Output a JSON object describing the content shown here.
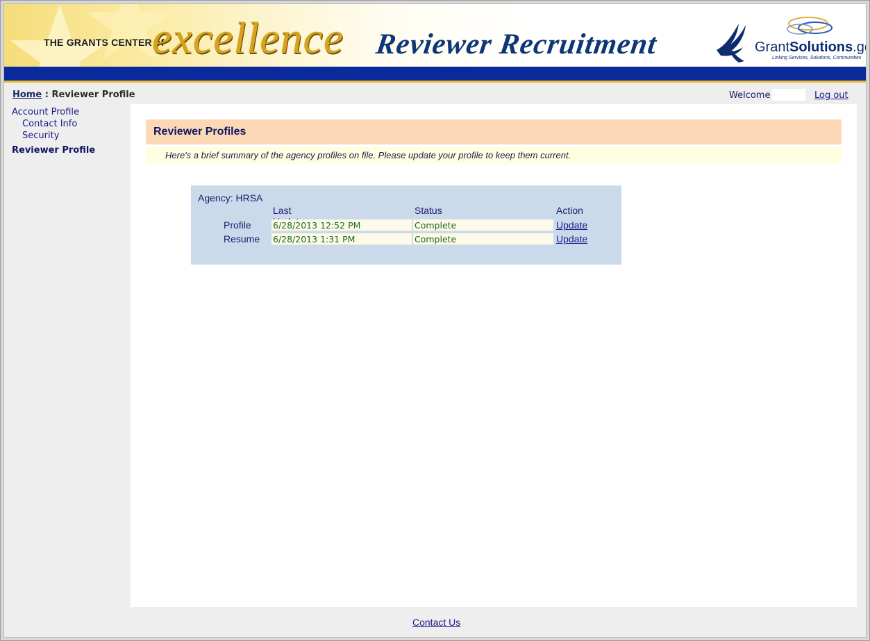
{
  "banner": {
    "brand_prefix": "THE GRANTS CENTER of",
    "brand_word": "excellence",
    "app_title": "Reviewer Recruitment",
    "logo_text_a": "Grant",
    "logo_text_b": "Solutions",
    "logo_text_c": ".gov",
    "logo_tagline": "Linking Services, Solutions, Communities"
  },
  "breadcrumb": {
    "home": "Home",
    "separator": " : ",
    "current": "Reviewer Profile"
  },
  "user": {
    "welcome": "Welcome",
    "logout": "Log out"
  },
  "sidebar": {
    "items": [
      {
        "label": "Account Profile"
      },
      {
        "label": "Contact Info"
      },
      {
        "label": "Security"
      },
      {
        "label": "Reviewer Profile"
      }
    ]
  },
  "main": {
    "title": "Reviewer Profiles",
    "subtitle": "Here's a brief summary of the agency profiles on file. Please update your profile to keep them current.",
    "agency_label": "Agency: HRSA",
    "columns": [
      "Last Update",
      "Status",
      "Action"
    ],
    "rows": [
      {
        "name": "Profile",
        "last_update": "6/28/2013 12:52 PM",
        "status": "Complete",
        "action": "Update"
      },
      {
        "name": "Resume",
        "last_update": "6/28/2013 1:31 PM",
        "status": "Complete",
        "action": "Update"
      }
    ]
  },
  "footer": {
    "contact": "Contact Us"
  },
  "colors": {
    "header_bar": "#0a2a9c",
    "accent_gold": "#f0b929",
    "section_head": "#fcd8b7",
    "agency_panel": "#cbdaeb",
    "status_text": "#1e6b1e"
  }
}
